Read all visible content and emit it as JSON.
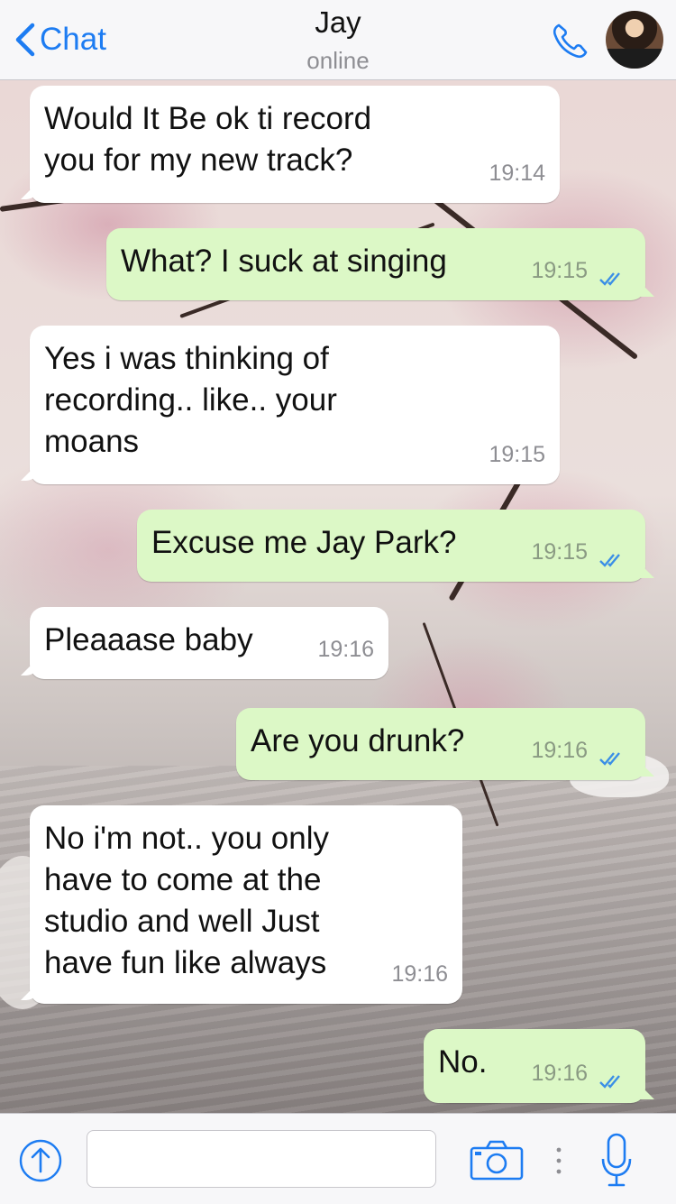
{
  "header": {
    "back_label": "Chat",
    "contact_name": "Jay",
    "status": "online"
  },
  "messages": [
    {
      "direction": "incoming",
      "text": "Would It Be ok ti record\nyou for my new track?",
      "time": "19:14"
    },
    {
      "direction": "outgoing",
      "text": "What? I suck at singing",
      "time": "19:15",
      "status": "read"
    },
    {
      "direction": "incoming",
      "text": "Yes i was thinking of\nrecording.. like.. your\nmoans",
      "time": "19:15"
    },
    {
      "direction": "outgoing",
      "text": "Excuse me Jay Park?",
      "time": "19:15",
      "status": "read"
    },
    {
      "direction": "incoming",
      "text": "Pleaaase baby",
      "time": "19:16"
    },
    {
      "direction": "outgoing",
      "text": "Are you drunk?",
      "time": "19:16",
      "status": "read"
    },
    {
      "direction": "incoming",
      "text": "No i'm not.. you only\nhave to come at the\nstudio and well Just\nhave fun like always",
      "time": "19:16"
    },
    {
      "direction": "outgoing",
      "text": "No.",
      "time": "19:16",
      "status": "read"
    }
  ],
  "input": {
    "value": "",
    "placeholder": ""
  },
  "icons": {
    "back": "chevron-left-icon",
    "call": "phone-icon",
    "upload": "upload-icon",
    "camera": "camera-icon",
    "mic": "microphone-icon",
    "read_receipt": "double-check-icon"
  },
  "colors": {
    "accent": "#1d7cf2",
    "outgoing_bubble": "#dcf8c6",
    "incoming_bubble": "#ffffff",
    "read_tick": "#3b8fe6"
  }
}
